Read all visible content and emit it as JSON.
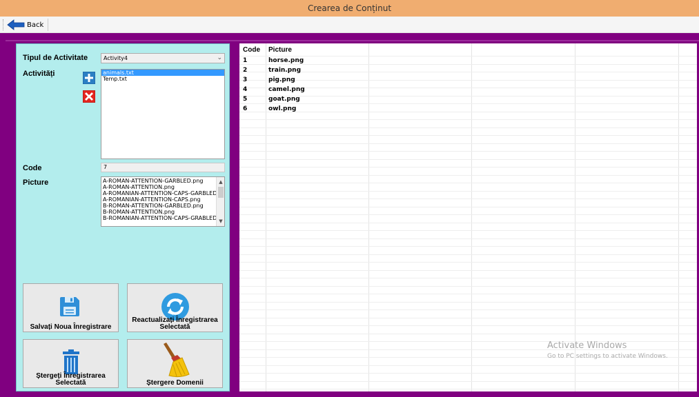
{
  "window": {
    "title": "Crearea de Conținut"
  },
  "toolbar": {
    "back_label": "Back"
  },
  "form": {
    "activity_type_label": "Tipul de Activitate",
    "activity_type_value": "Activity4",
    "activities_label": "Activități",
    "activities": [
      "animals.txt",
      "Temp.txt"
    ],
    "selected_activity": "animals.txt",
    "code_label": "Code",
    "code_value": "7",
    "picture_label": "Picture",
    "pictures": [
      "A-ROMAN-ATTENTION-GARBLED.png",
      "A-ROMAN-ATTENTION.png",
      "A-ROMANIAN-ATTENTION-CAPS-GARBLED",
      "A-ROMANIAN-ATTENTION-CAPS.png",
      "B-ROMAN-ATTENTION-GARBLED.png",
      "B-ROMAN-ATTENTION.png",
      "B-ROMANIAN-ATTENTION-CAPS-GRABLED"
    ]
  },
  "actions": {
    "save_label": "Salvați Noua Înregistrare",
    "refresh_label_1": "Reactualizați Înregistrarea",
    "refresh_label_2": "Selectată",
    "delete_label_1": "Ștergeți Înregistrarea",
    "delete_label_2": "Selectată",
    "clear_label": "Ștergere Domenii"
  },
  "table": {
    "columns": [
      "Code",
      "Picture"
    ],
    "rows": [
      {
        "code": "1",
        "picture": "horse.png"
      },
      {
        "code": "2",
        "picture": "train.png"
      },
      {
        "code": "3",
        "picture": "pig.png"
      },
      {
        "code": "4",
        "picture": "camel.png"
      },
      {
        "code": "5",
        "picture": "goat.png"
      },
      {
        "code": "6",
        "picture": "owl.png"
      }
    ]
  },
  "watermark": {
    "line1": "Activate Windows",
    "line2": "Go to PC settings to activate Windows."
  },
  "icons": {
    "back": "back-arrow-icon",
    "add": "plus-icon",
    "remove": "close-icon",
    "save": "floppy-disk-icon",
    "refresh": "refresh-icon",
    "delete": "trash-can-icon",
    "clear": "broom-icon"
  },
  "colors": {
    "titlebar": "#f0ad70",
    "frame": "#800080",
    "panel": "#b3eded",
    "selection": "#3399ff"
  }
}
